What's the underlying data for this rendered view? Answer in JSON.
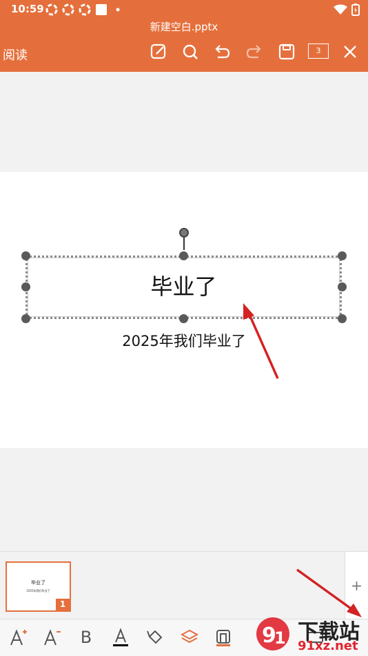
{
  "status": {
    "time": "10:59"
  },
  "header": {
    "title": "新建空白.pptx",
    "read_label": "阅读",
    "page_count": "3"
  },
  "slide": {
    "title": "毕业了",
    "subtitle": "2025年我们毕业了"
  },
  "thumbnails": [
    {
      "title": "毕业了",
      "subtitle": "2025年我们毕业了",
      "number": "1"
    }
  ],
  "thumbs_panel": {
    "add_label": "+"
  },
  "bottom_toolbar": {
    "items": [
      "font-increase-icon",
      "font-decrease-icon",
      "bold-icon",
      "font-color-icon",
      "fill-color-icon",
      "layers-icon",
      "shape-style-icon",
      "keyboard-icon"
    ],
    "bold_label": "B"
  },
  "watermark": {
    "text": "下载站",
    "url": "91xz.net"
  },
  "colors": {
    "accent": "#e56f3c",
    "arrow": "#d32222"
  }
}
